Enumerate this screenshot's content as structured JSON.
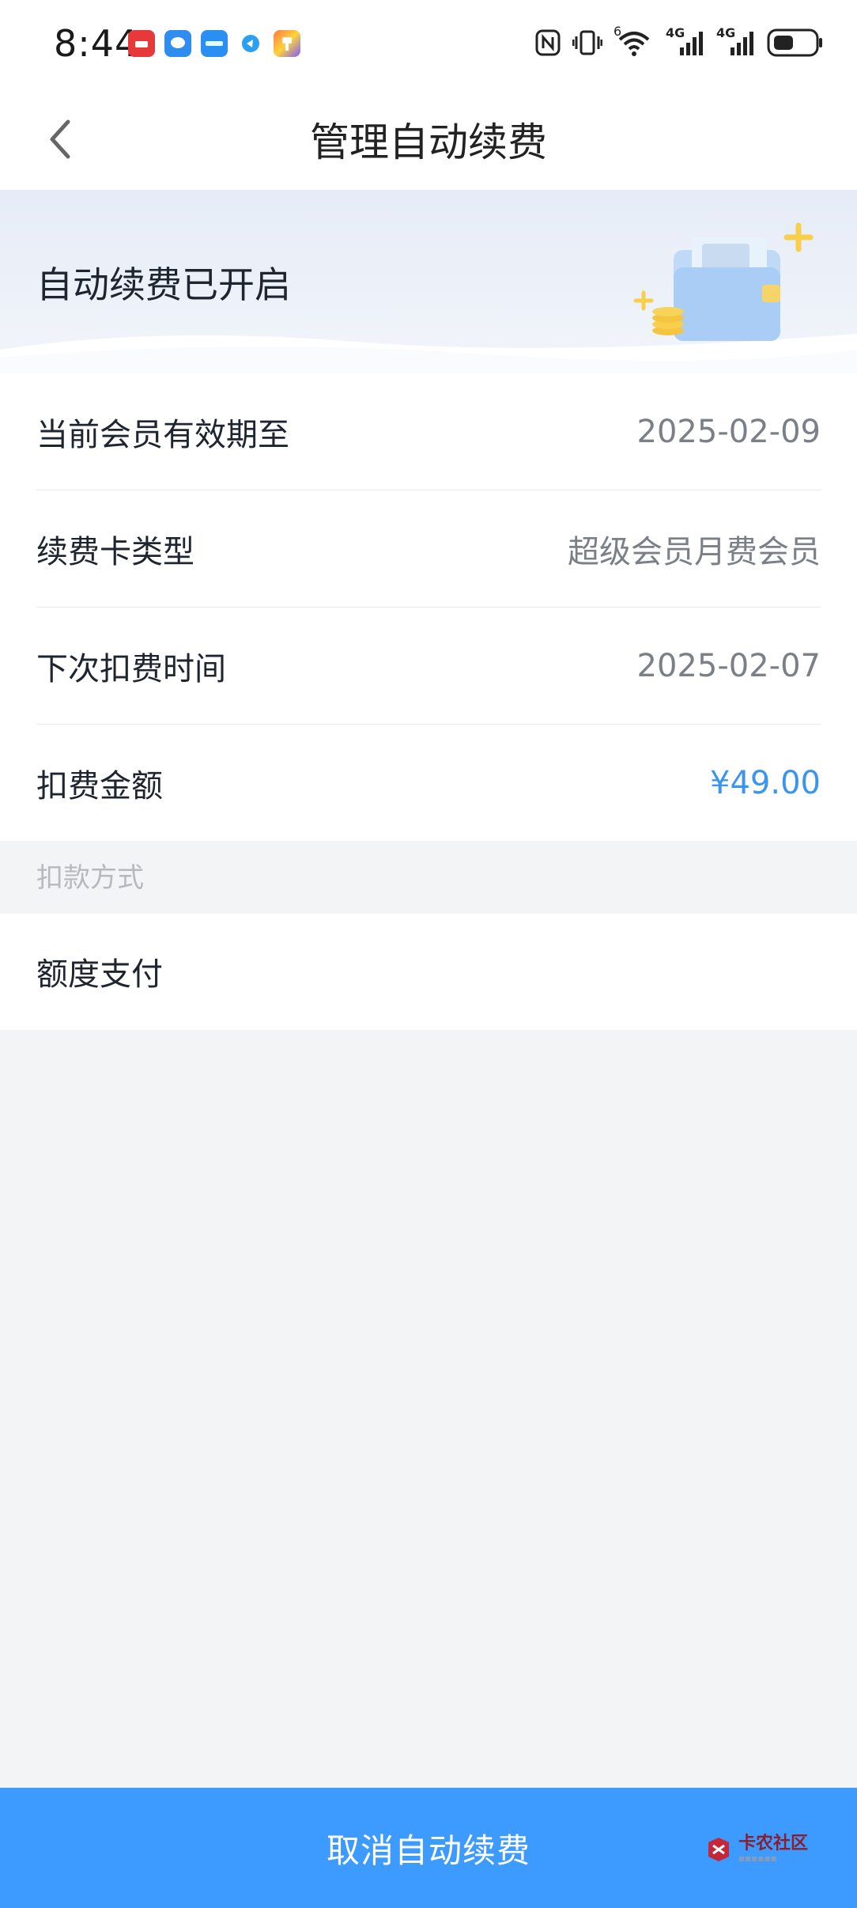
{
  "status_bar": {
    "time": "8:44",
    "app_icons": [
      "huawei-appgallery-icon",
      "messages-icon",
      "app-icon",
      "browser-icon",
      "theme-icon"
    ],
    "sys_icons": [
      "nfc-icon",
      "vibrate-icon",
      "wifi-icon",
      "signal-4g-icon",
      "signal-4g-icon",
      "battery-icon"
    ],
    "wifi_label": "6",
    "network_label_1": "4G",
    "network_label_2": "4G"
  },
  "nav": {
    "title": "管理自动续费"
  },
  "banner": {
    "status": "自动续费已开启"
  },
  "details": [
    {
      "label": "当前会员有效期至",
      "value": "2025-02-09"
    },
    {
      "label": "续费卡类型",
      "value": "超级会员月费会员"
    },
    {
      "label": "下次扣费时间",
      "value": "2025-02-07"
    },
    {
      "label": "扣费金额",
      "value": "¥49.00"
    }
  ],
  "payment": {
    "section_label": "扣款方式",
    "method": "额度支付"
  },
  "footer": {
    "cancel_label": "取消自动续费"
  },
  "watermark": {
    "text": "卡农社区"
  },
  "colors": {
    "accent": "#3d9bff",
    "price": "#3a95f0",
    "page_bg": "#f3f4f5"
  }
}
